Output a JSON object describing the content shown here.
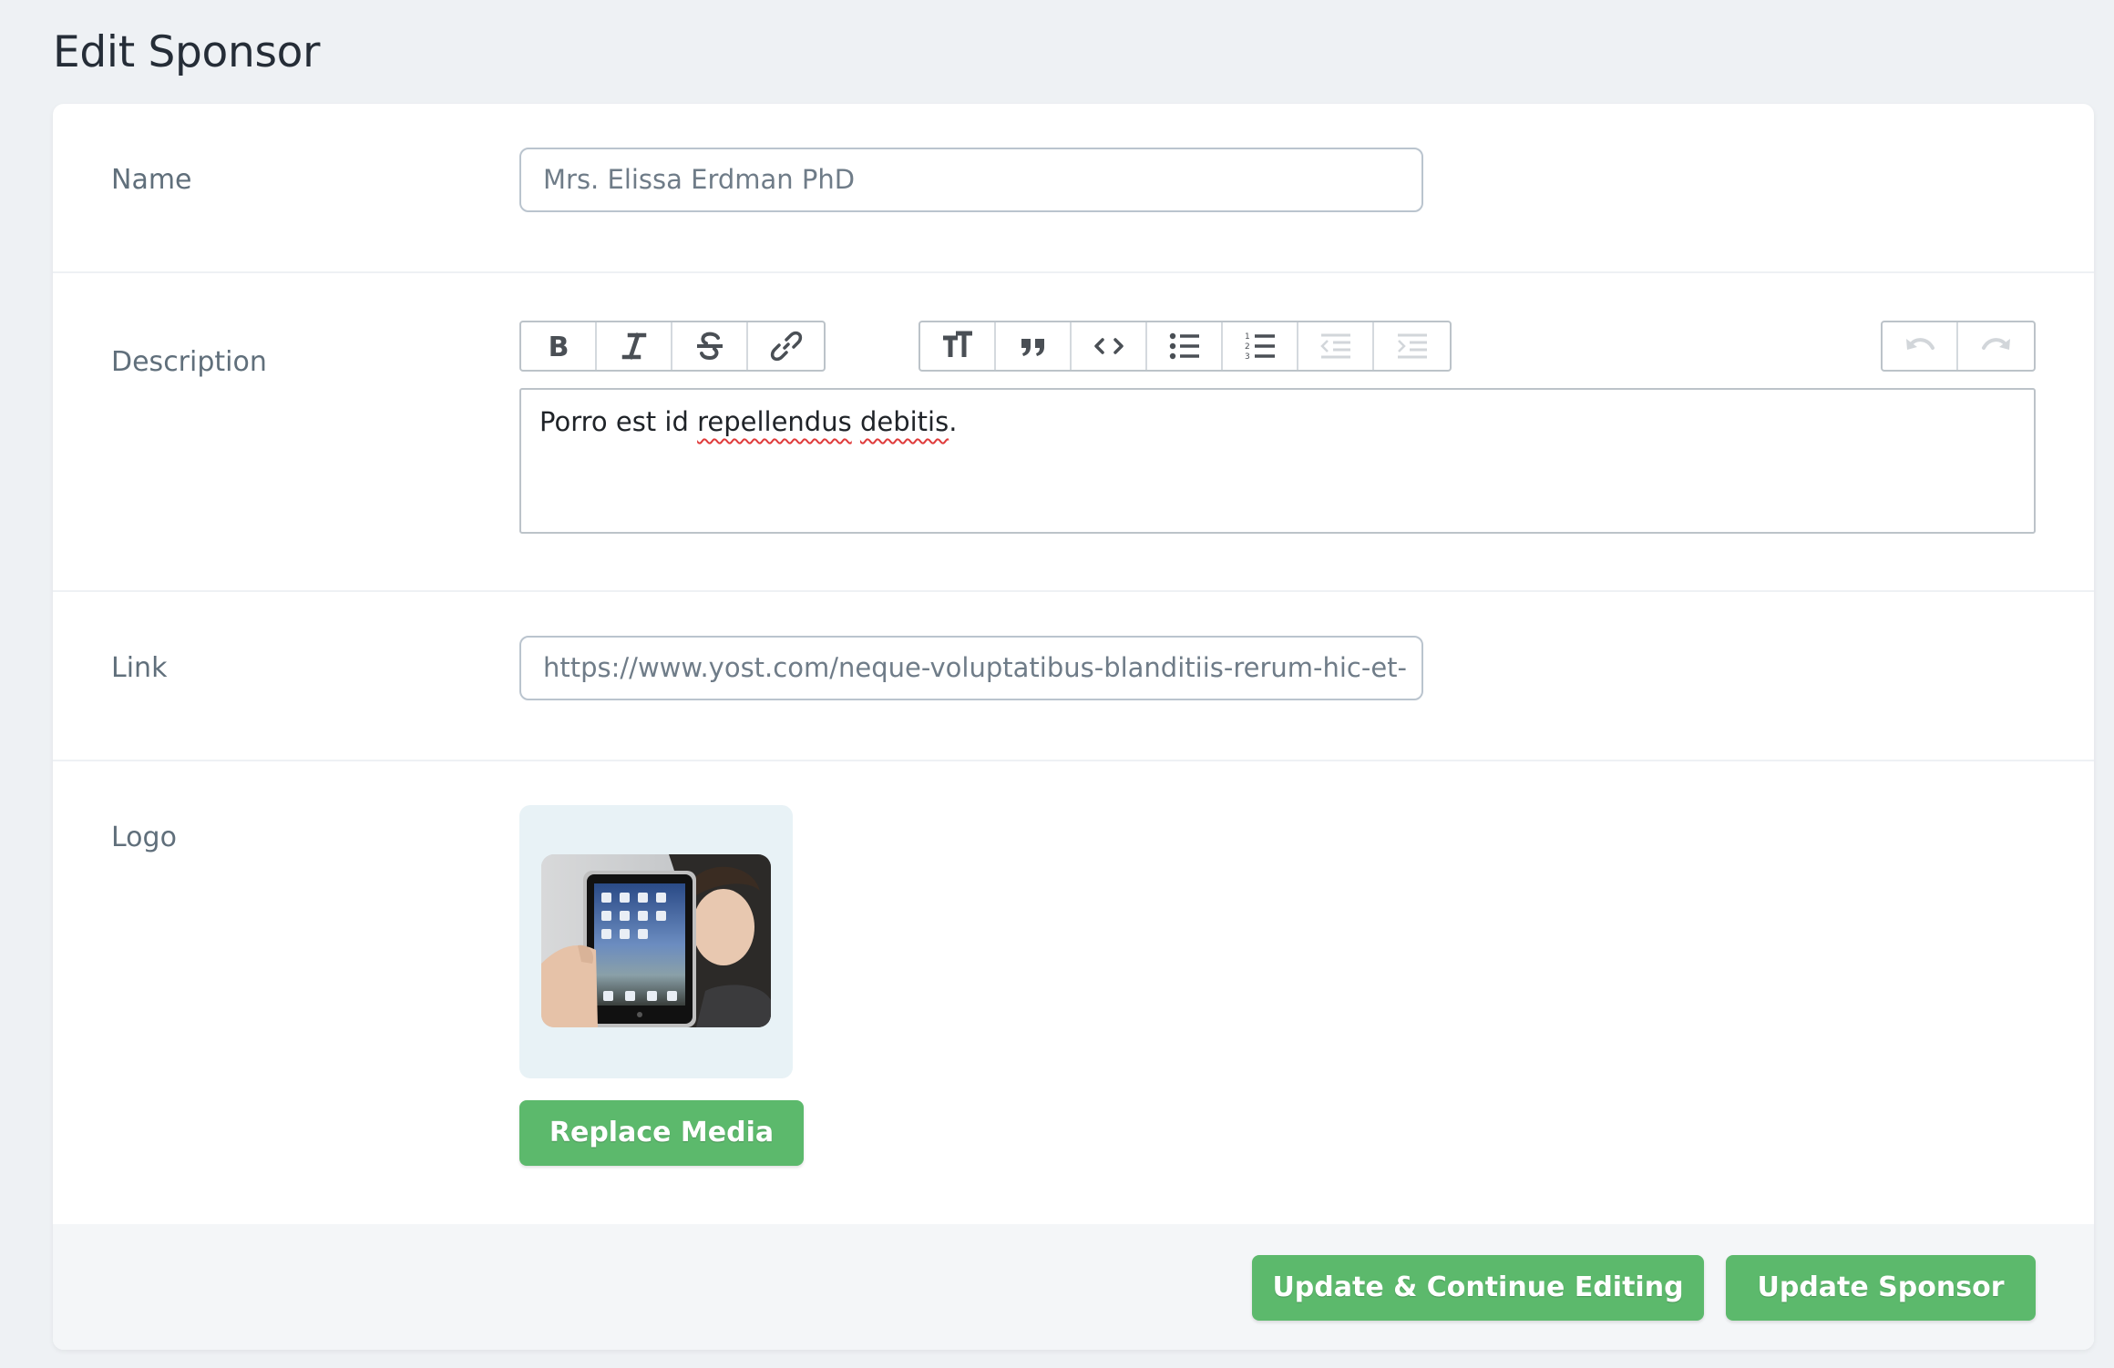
{
  "page": {
    "title": "Edit Sponsor"
  },
  "fields": {
    "name": {
      "label": "Name",
      "value": "Mrs. Elissa Erdman PhD"
    },
    "description": {
      "label": "Description",
      "value_plain": "Porro est id ",
      "value_misspelled_1": "repellendus",
      "value_space": " ",
      "value_misspelled_2": "debitis",
      "value_end": "."
    },
    "link": {
      "label": "Link",
      "value": "https://www.yost.com/neque-voluptatibus-blanditiis-rerum-hic-et-"
    },
    "logo": {
      "label": "Logo",
      "replace_label": "Replace Media"
    }
  },
  "toolbar": {
    "icons": [
      "bold-icon",
      "italic-icon",
      "strikethrough-icon",
      "link-icon",
      "heading-icon",
      "quote-icon",
      "code-icon",
      "bullet-list-icon",
      "numbered-list-icon",
      "outdent-icon",
      "indent-icon",
      "undo-icon",
      "redo-icon"
    ]
  },
  "footer": {
    "continue_label": "Update & Continue Editing",
    "update_label": "Update Sponsor"
  },
  "colors": {
    "accent": "#5cb96c",
    "background": "#eef1f4",
    "logo_bg": "#e8f2f6"
  }
}
